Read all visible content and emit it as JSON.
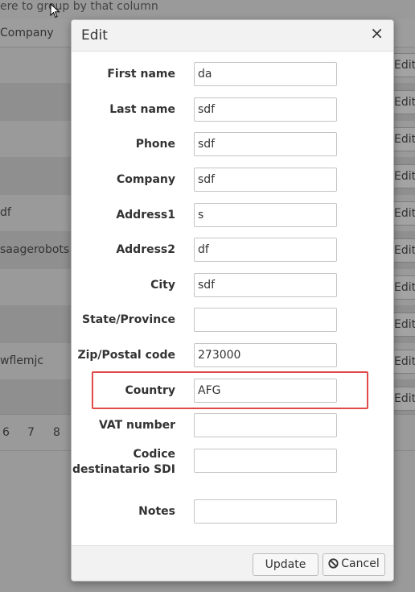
{
  "background": {
    "group_hint": "ere to group by that column",
    "column_header": "Company",
    "rows": [
      {
        "cell": "",
        "edit": "Edit"
      },
      {
        "cell": "",
        "edit": "Edit"
      },
      {
        "cell": "",
        "edit": "Edit"
      },
      {
        "cell": "",
        "edit": "Edit"
      },
      {
        "cell": "df",
        "edit": "Edit"
      },
      {
        "cell": "saagerobots",
        "edit": "Edit"
      },
      {
        "cell": "",
        "edit": "Edit"
      },
      {
        "cell": "",
        "edit": "Edit"
      },
      {
        "cell": "wflemjc",
        "edit": "Edit"
      },
      {
        "cell": "",
        "edit": "Edit"
      }
    ],
    "pager": [
      "6",
      "7",
      "8"
    ]
  },
  "modal": {
    "title": "Edit",
    "close": "×",
    "fields": [
      {
        "label": "First name",
        "value": "da"
      },
      {
        "label": "Last name",
        "value": "sdf"
      },
      {
        "label": "Phone",
        "value": "sdf"
      },
      {
        "label": "Company",
        "value": "sdf"
      },
      {
        "label": "Address1",
        "value": "s"
      },
      {
        "label": "Address2",
        "value": "df"
      },
      {
        "label": "City",
        "value": "sdf"
      },
      {
        "label": "State/Province",
        "value": ""
      },
      {
        "label": "Zip/Postal code",
        "value": "273000"
      },
      {
        "label": "Country",
        "value": "AFG"
      },
      {
        "label": "VAT number",
        "value": ""
      },
      {
        "label_line1": "Codice",
        "label_line2": "destinatario SDI",
        "value": ""
      },
      {
        "label": "Notes",
        "value": ""
      }
    ],
    "buttons": {
      "update": "Update",
      "cancel": "Cancel"
    }
  },
  "colors": {
    "highlight": "#e04a4a"
  }
}
